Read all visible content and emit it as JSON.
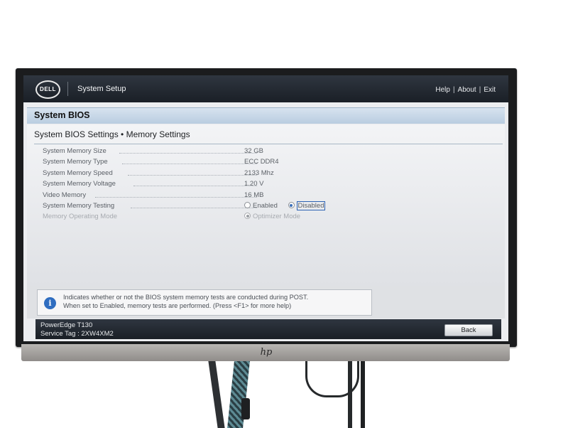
{
  "header": {
    "logo_text": "DELL",
    "app_title": "System Setup",
    "nav": [
      "Help",
      "About",
      "Exit"
    ],
    "nav_separator": "|"
  },
  "page": {
    "title": "System BIOS",
    "breadcrumb": "System BIOS Settings • Memory Settings"
  },
  "settings": [
    {
      "label": "System Memory Size",
      "value": "32 GB"
    },
    {
      "label": "System Memory Type",
      "value": "ECC DDR4"
    },
    {
      "label": "System Memory Speed",
      "value": "2133 Mhz"
    },
    {
      "label": "System Memory Voltage",
      "value": "1.20 V"
    },
    {
      "label": "Video Memory",
      "value": "16 MB"
    },
    {
      "label": "System Memory Testing",
      "options": [
        "Enabled",
        "Disabled"
      ],
      "selected": "Disabled"
    },
    {
      "label": "Memory Operating Mode",
      "options": [
        "Optimizer Mode"
      ],
      "selected": "Optimizer Mode",
      "disabled": true
    }
  ],
  "help": {
    "icon": "info-icon",
    "line1": "Indicates whether or not the BIOS system memory tests are conducted during POST.",
    "line2": "When set to Enabled, memory tests are performed. (Press <F1> for more help)"
  },
  "footer": {
    "model": "PowerEdge T130",
    "service_tag": "Service Tag : 2XW4XM2",
    "back_label": "Back"
  },
  "monitor": {
    "brand_icon": "hp-logo-icon"
  },
  "colors": {
    "bar_dark": "#1f252d",
    "accent_blue": "#2f6dc0",
    "page_head": "#c7d7e7"
  }
}
